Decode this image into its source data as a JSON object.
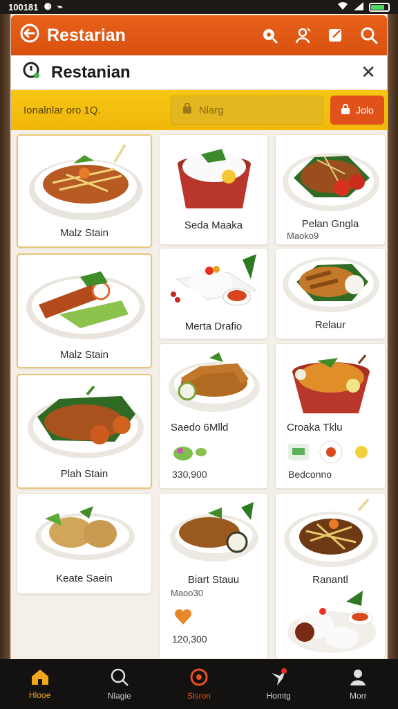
{
  "status": {
    "time": "100181",
    "colors": {
      "battery": "#4cd964"
    }
  },
  "app_bar": {
    "title": "Restarian",
    "icons": [
      "search-settings-icon",
      "share-icon",
      "edit-icon",
      "search-icon"
    ]
  },
  "dialog": {
    "title": "Restanian"
  },
  "filter": {
    "label": "Ionalnlar oro 1Q.",
    "search_placeholder": "Nlarg",
    "button_label": "Jolo"
  },
  "cards": [
    {
      "name": "Malz Stain"
    },
    {
      "name": "Seda Maaka"
    },
    {
      "name": "Pelan Gngla",
      "meta": "Maoko9"
    },
    {
      "name": "Malz Stain"
    },
    {
      "name": "Merta Drafio"
    },
    {
      "name": "Relaur"
    },
    {
      "name": "Plah Stain"
    },
    {
      "name": "Saedo 6Mlld",
      "price": "330,900"
    },
    {
      "name": "Croaka Tklu",
      "price": "Bedconno"
    },
    {
      "name": "Keate Saein"
    },
    {
      "name": "Biart Stauu",
      "meta": "Maoo30",
      "price": "120,300"
    },
    {
      "name": "Ranantl"
    }
  ],
  "nav": [
    {
      "label": "Hlooe",
      "icon": "home-icon"
    },
    {
      "label": "Nlagie",
      "icon": "search-icon"
    },
    {
      "label": "Slsron",
      "icon": "record-icon"
    },
    {
      "label": "Homtg",
      "icon": "bird-icon"
    },
    {
      "label": "Morr",
      "icon": "profile-icon"
    }
  ],
  "colors": {
    "accent": "#e8621b",
    "filter_bg": "#f7c613",
    "nav_active": "#f2a51e",
    "nav_bg": "#141210"
  }
}
